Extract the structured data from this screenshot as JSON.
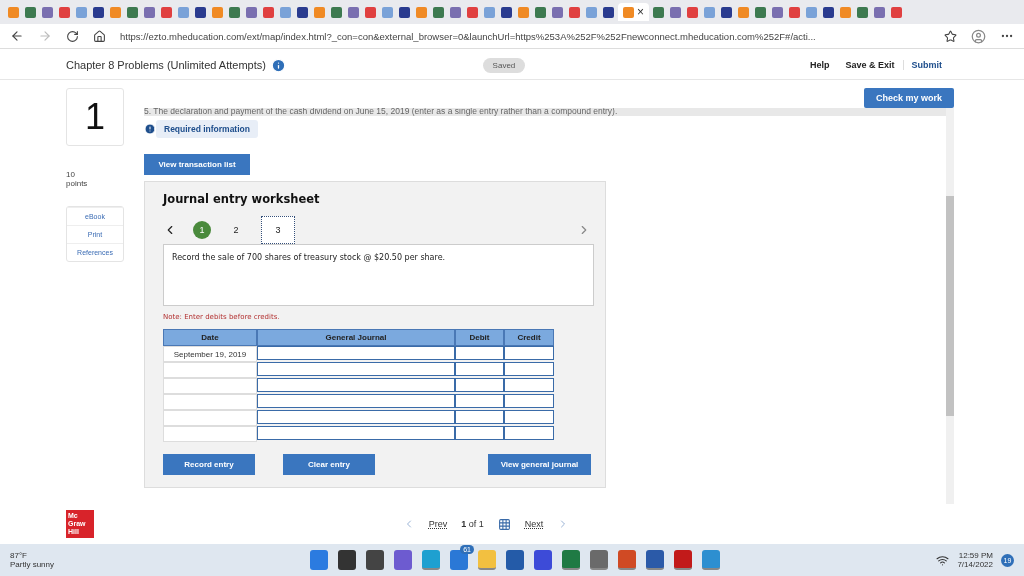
{
  "browser": {
    "tabs": [
      {
        "selected": false
      },
      {
        "selected": false
      },
      {
        "selected": false
      },
      {
        "selected": false
      },
      {
        "selected": false
      },
      {
        "selected": false
      },
      {
        "selected": false
      },
      {
        "selected": false
      },
      {
        "selected": false
      },
      {
        "selected": false
      },
      {
        "selected": false
      },
      {
        "selected": false
      },
      {
        "selected": false
      },
      {
        "selected": false
      },
      {
        "selected": false
      },
      {
        "selected": false
      },
      {
        "selected": false
      },
      {
        "selected": false
      },
      {
        "selected": false
      },
      {
        "selected": false
      },
      {
        "selected": false
      },
      {
        "selected": false
      },
      {
        "selected": false
      },
      {
        "selected": false
      },
      {
        "selected": false
      },
      {
        "selected": false
      },
      {
        "selected": false
      },
      {
        "selected": false
      },
      {
        "selected": false
      },
      {
        "selected": false
      },
      {
        "selected": false
      },
      {
        "selected": false
      },
      {
        "selected": false
      },
      {
        "selected": false
      },
      {
        "selected": false
      },
      {
        "selected": false
      },
      {
        "selected": true,
        "close": "×"
      },
      {
        "selected": false
      },
      {
        "selected": false
      },
      {
        "selected": false
      },
      {
        "selected": false
      },
      {
        "selected": false
      },
      {
        "selected": false
      },
      {
        "selected": false
      },
      {
        "selected": false
      },
      {
        "selected": false
      },
      {
        "selected": false
      },
      {
        "selected": false
      },
      {
        "selected": false
      },
      {
        "selected": false
      },
      {
        "selected": false
      },
      {
        "selected": false
      }
    ],
    "url": "https://ezto.mheducation.com/ext/map/index.html?_con=con&external_browser=0&launchUrl=https%253A%252F%252Fnewconnect.mheducation.com%252F#/acti..."
  },
  "header": {
    "title": "Chapter 8 Problems (Unlimited Attempts)",
    "status": "Saved",
    "actions": [
      "Help",
      "Save & Exit",
      "Submit"
    ]
  },
  "question": {
    "number": "1",
    "points": "10",
    "points_label": "points",
    "links": [
      "eBook",
      "Print",
      "References"
    ],
    "check_button": "Check my work",
    "prompt": "5. The declaration and payment of the cash dividend on June 15, 2019 (enter as a single entry rather than a compound entry).",
    "required_info": "Required information",
    "transaction_button": "View transaction list"
  },
  "worksheet": {
    "title": "Journal entry worksheet",
    "steps": [
      {
        "label": "1",
        "selected": false,
        "completed": true
      },
      {
        "label": "2",
        "selected": false,
        "completed": false
      },
      {
        "label": "3",
        "selected": true,
        "completed": false
      }
    ],
    "instruction": "Record the sale of 700 shares of treasury stock @ $20.50 per share.",
    "note": "Note: Enter debits before credits.",
    "columns": [
      "Date",
      "General Journal",
      "Debit",
      "Credit"
    ],
    "rows": [
      {
        "date": "September 19, 2019"
      },
      {},
      {},
      {},
      {},
      {}
    ],
    "buttons": [
      "Record entry",
      "Clear entry",
      "View general journal"
    ]
  },
  "footer": {
    "logo": [
      "Mc",
      "Graw",
      "Hill"
    ],
    "prev": "Prev",
    "page": "1",
    "of": "of",
    "total": "1",
    "next": "Next"
  },
  "taskbar": {
    "temperature": "87°F",
    "weather": "Partly sunny",
    "apps": [
      {
        "kind": "start",
        "running": false
      },
      {
        "kind": "search",
        "running": false
      },
      {
        "kind": "taskview",
        "running": false
      },
      {
        "kind": "chat",
        "running": false
      },
      {
        "kind": "browser",
        "running": true
      },
      {
        "kind": "mail",
        "running": false,
        "badge": "61"
      },
      {
        "kind": "folder",
        "running": true
      },
      {
        "kind": "store",
        "running": false
      },
      {
        "kind": "app",
        "running": false
      },
      {
        "kind": "excel",
        "running": true
      },
      {
        "kind": "calculator",
        "running": true
      },
      {
        "kind": "powerpoint",
        "running": true
      },
      {
        "kind": "word",
        "running": true
      },
      {
        "kind": "pdf",
        "running": true
      },
      {
        "kind": "photos",
        "running": true
      }
    ],
    "time": "12:59 PM",
    "date": "7/14/2022",
    "notifications": "19"
  }
}
